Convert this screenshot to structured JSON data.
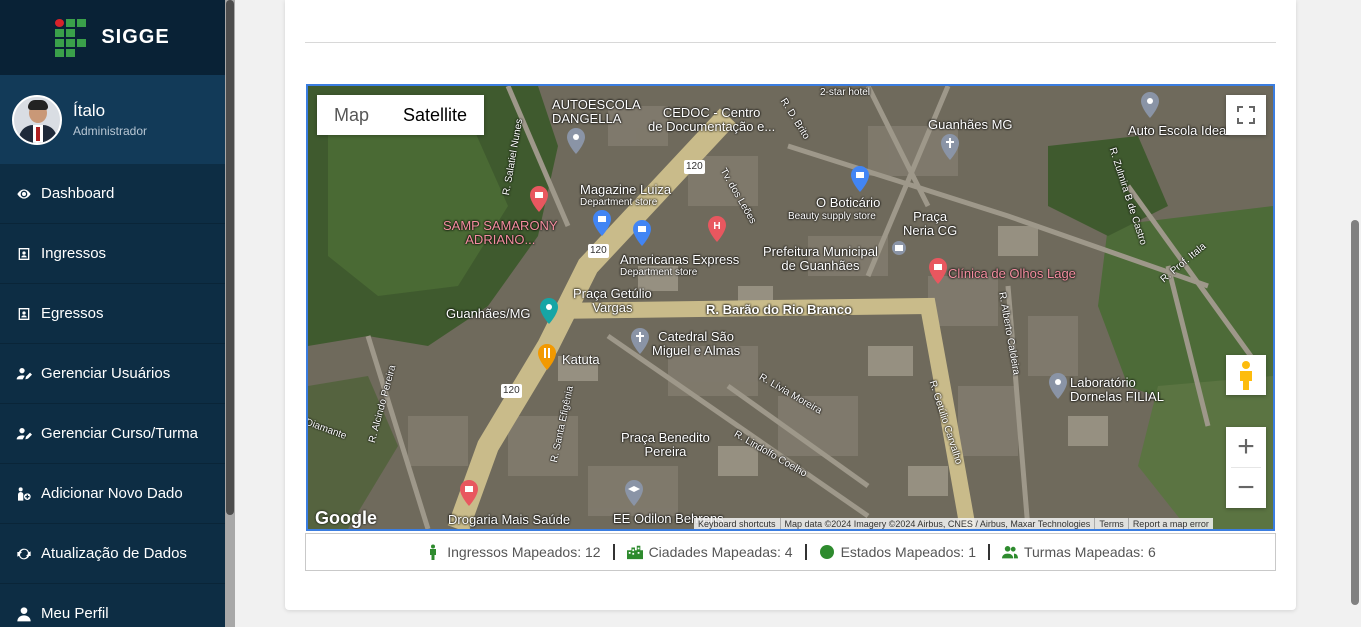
{
  "brand": {
    "name": "SIGGE"
  },
  "user": {
    "name": "Ítalo",
    "role": "Administrador"
  },
  "nav": [
    {
      "label": "Dashboard",
      "icon": "eye-icon"
    },
    {
      "label": "Ingressos",
      "icon": "id-card-icon"
    },
    {
      "label": "Egressos",
      "icon": "id-card-icon"
    },
    {
      "label": "Gerenciar Usuários",
      "icon": "user-edit-icon"
    },
    {
      "label": "Gerenciar Curso/Turma",
      "icon": "user-edit-icon"
    },
    {
      "label": "Adicionar Novo Dado",
      "icon": "user-add-icon"
    },
    {
      "label": "Atualização de Dados",
      "icon": "sync-icon"
    },
    {
      "label": "Meu Perfil",
      "icon": "user-icon"
    }
  ],
  "map": {
    "type_map": "Map",
    "type_satellite": "Satellite",
    "selected_type": "Satellite",
    "labels": {
      "autoescola": "AUTOESCOLA\nDANGELLA",
      "cedoc": "CEDOC - Centro\nde Documentação e...",
      "hotel": "2-star hotel",
      "brito": "R. D. Brito",
      "guanhaes_mg_top": "Guanhães MG",
      "auto_escola": "Auto Escola Ideal",
      "salatiel": "R. Salatiel Nunes",
      "magazine": "Magazine Luiza",
      "magazine_sub": "Department store",
      "samp": "SAMP SAMARONY\nADRIANO...",
      "leoes": "Tv. dos Leões",
      "boticario": "O Boticário",
      "boticario_sub": "Beauty supply store",
      "praca_neria": "Praça\nNeria CG",
      "americanas": "Americanas Express",
      "americanas_sub": "Department store",
      "prefeitura": "Prefeitura Municipal\nde Guanhães",
      "clinica": "Clínica de Olhos Lage",
      "praca_getulio": "Praça Getúlio\nVargas",
      "guanhaes_mg": "Guanhães/MG",
      "barao": "R. Barão do Rio Branco",
      "catedral": "Catedral São\nMiguel e Almas",
      "katuta": "Katuta",
      "alberto": "R. Alberto Caldeira",
      "laboratorio": "Laboratório\nDornelas FILIAL",
      "livia": "R. Lívia Moreira",
      "alcindo": "R. Alcindo Pereira",
      "diamante": "Diamante",
      "santa": "R. Santa Efigênia",
      "praca_benedito": "Praça Benedito\nPereira",
      "lindolfo": "R. Lindolfo Coelho",
      "getulio": "R. Getúlio Carvalho",
      "drogaria": "Drogaria Mais Saúde",
      "odilon": "EE Odilon Behrens",
      "zulmira": "R. Zulmira B de Castro",
      "itala": "R. Prof. Itala",
      "road120a": "120",
      "road120b": "120",
      "road120c": "120"
    },
    "google": "Google",
    "footer": {
      "shortcuts": "Keyboard shortcuts",
      "data": "Map data ©2024 Imagery ©2024 Airbus, CNES / Airbus, Maxar Technologies",
      "terms": "Terms",
      "report": "Report a map error"
    }
  },
  "stats": {
    "ingressos": "Ingressos Mapeados: 12",
    "cidades": "Ciadades Mapeadas: 4",
    "estados": "Estados Mapeados: 1",
    "turmas": "Turmas Mapeadas: 6"
  },
  "colors": {
    "sidebar": "#0d2d44",
    "accent_green": "#2e8b2e",
    "map_border": "#3b7de0"
  }
}
